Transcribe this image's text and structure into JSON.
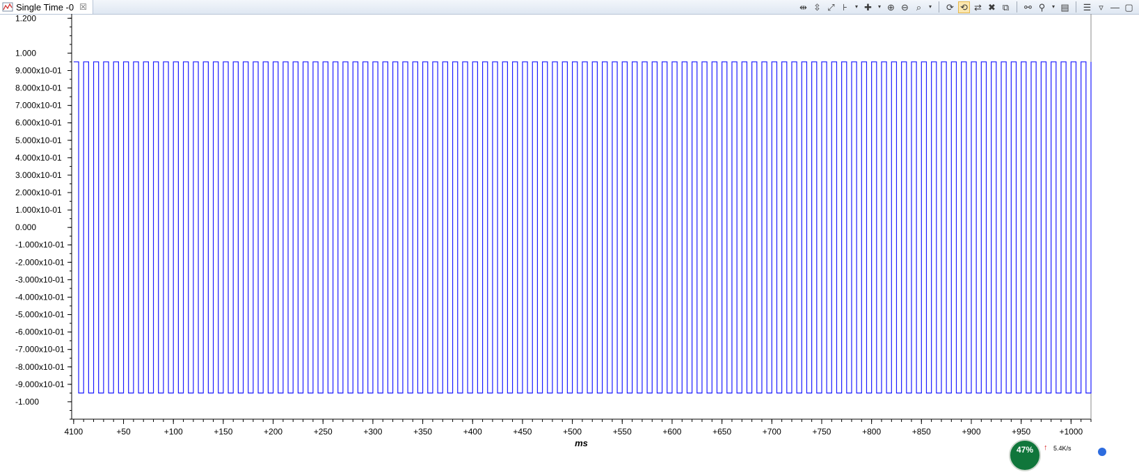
{
  "tab": {
    "title": "Single Time -0",
    "close_glyph": "☒"
  },
  "toolbar": {
    "buttons": [
      {
        "name": "auto-scale-x-icon",
        "glyph": "⇹",
        "pressed": false
      },
      {
        "name": "auto-scale-y-icon",
        "glyph": "⇳",
        "pressed": false
      },
      {
        "name": "auto-scale-all-icon",
        "glyph": "⤢",
        "pressed": false
      },
      {
        "name": "cursor-marker-icon",
        "glyph": "⊦",
        "pressed": false
      },
      {
        "name": "dropdown-arrow-icon",
        "glyph": "▾",
        "pressed": false,
        "dd": true
      },
      {
        "name": "add-marker-icon",
        "glyph": "✚",
        "pressed": false
      },
      {
        "name": "dropdown-arrow-icon",
        "glyph": "▾",
        "pressed": false,
        "dd": true
      },
      {
        "name": "zoom-in-icon",
        "glyph": "⊕",
        "pressed": false
      },
      {
        "name": "zoom-out-icon",
        "glyph": "⊖",
        "pressed": false
      },
      {
        "name": "zoom-area-icon",
        "glyph": "⌕",
        "pressed": false
      },
      {
        "name": "dropdown-arrow-icon",
        "glyph": "▾",
        "pressed": false,
        "dd": true
      },
      {
        "name": "separator",
        "sep": true
      },
      {
        "name": "refresh-icon",
        "glyph": "⟳",
        "pressed": false
      },
      {
        "name": "refresh-all-icon",
        "glyph": "⟲",
        "pressed": true
      },
      {
        "name": "sync-icon",
        "glyph": "⇄",
        "pressed": false
      },
      {
        "name": "delete-icon",
        "glyph": "✖",
        "pressed": false
      },
      {
        "name": "export-icon",
        "glyph": "⧉",
        "pressed": false
      },
      {
        "name": "separator",
        "sep": true
      },
      {
        "name": "binoculars-icon",
        "glyph": "⚯",
        "pressed": false
      },
      {
        "name": "pin-icon",
        "glyph": "⚲",
        "pressed": false
      },
      {
        "name": "dropdown-arrow-icon",
        "glyph": "▾",
        "pressed": false,
        "dd": true
      },
      {
        "name": "layout-icon",
        "glyph": "▤",
        "pressed": false
      },
      {
        "name": "separator",
        "sep": true
      },
      {
        "name": "list-icon",
        "glyph": "☰",
        "pressed": false
      },
      {
        "name": "view-menu-icon",
        "glyph": "▿",
        "pressed": false
      },
      {
        "name": "minimize-icon",
        "glyph": "—",
        "pressed": false
      },
      {
        "name": "maximize-icon",
        "glyph": "▢",
        "pressed": false
      }
    ]
  },
  "chart_data": {
    "type": "line",
    "signal": "square wave",
    "y_tick_labels": [
      "1.200",
      "1.000",
      "9.000x10-01",
      "8.000x10-01",
      "7.000x10-01",
      "6.000x10-01",
      "5.000x10-01",
      "4.000x10-01",
      "3.000x10-01",
      "2.000x10-01",
      "1.000x10-01",
      "0.000",
      "-1.000x10-01",
      "-2.000x10-01",
      "-3.000x10-01",
      "-4.000x10-01",
      "-5.000x10-01",
      "-6.000x10-01",
      "-7.000x10-01",
      "-8.000x10-01",
      "-9.000x10-01",
      "-1.000"
    ],
    "y_tick_values": [
      1.2,
      1.0,
      0.9,
      0.8,
      0.7,
      0.6,
      0.5,
      0.4,
      0.3,
      0.2,
      0.1,
      0.0,
      -0.1,
      -0.2,
      -0.3,
      -0.4,
      -0.5,
      -0.6,
      -0.7,
      -0.8,
      -0.9,
      -1.0
    ],
    "ylim": [
      -1.1,
      1.225
    ],
    "x_tick_labels": [
      "4100",
      "+50",
      "+100",
      "+150",
      "+200",
      "+250",
      "+300",
      "+350",
      "+400",
      "+450",
      "+500",
      "+550",
      "+600",
      "+650",
      "+700",
      "+750",
      "+800",
      "+850",
      "+900",
      "+950",
      "+1000"
    ],
    "x_tick_values": [
      0,
      50,
      100,
      150,
      200,
      250,
      300,
      350,
      400,
      450,
      500,
      550,
      600,
      650,
      700,
      750,
      800,
      850,
      900,
      950,
      1000
    ],
    "xlim": [
      -2,
      1020
    ],
    "xlabel": "ms",
    "amplitude": 0.95,
    "period_ms": 10,
    "x_start_ms": 0,
    "x_end_ms": 1020,
    "line_color": "#1a1aff",
    "grid": false
  },
  "tray": {
    "gauge_text": "47%",
    "speed_text": "5.4K/s",
    "arrow_glyph": "↑"
  }
}
